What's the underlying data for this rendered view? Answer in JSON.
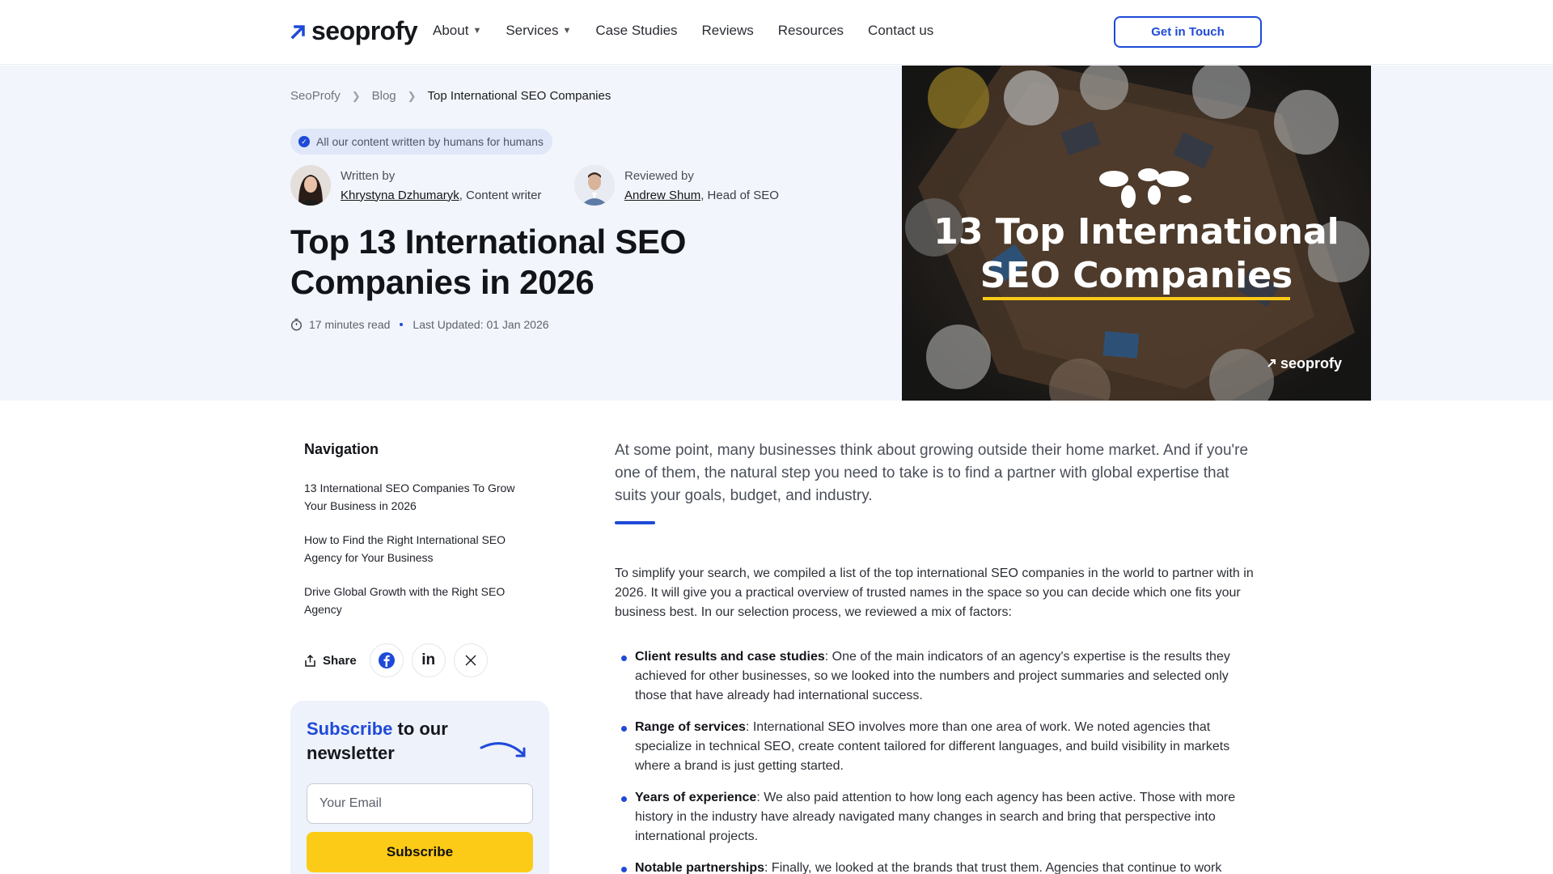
{
  "header": {
    "logo_text": "seoprofy",
    "nav": [
      {
        "label": "About",
        "has_dropdown": true
      },
      {
        "label": "Services",
        "has_dropdown": true
      },
      {
        "label": "Case Studies",
        "has_dropdown": false
      },
      {
        "label": "Reviews",
        "has_dropdown": false
      },
      {
        "label": "Resources",
        "has_dropdown": false
      },
      {
        "label": "Contact us",
        "has_dropdown": false
      }
    ],
    "cta_label": "Get in Touch"
  },
  "breadcrumb": [
    "SeoProfy",
    "Blog",
    "Top International SEO Companies"
  ],
  "badge_text": "All our content written by humans for humans",
  "authors": [
    {
      "role_label": "Written by",
      "name": "Khrystyna Dzhumaryk",
      "title": ", Content writer"
    },
    {
      "role_label": "Reviewed by",
      "name": "Andrew Shum",
      "title": ", Head of SEO"
    }
  ],
  "title": "Top 13 International SEO Companies in 2026",
  "read_time": "17 minutes read",
  "last_updated": "Last Updated: 01 Jan 2026",
  "hero_image": {
    "line1": "13 Top International",
    "line2": "SEO Companies",
    "brand": "seoprofy"
  },
  "sidebar": {
    "nav_title": "Navigation",
    "toc": [
      "13 International SEO Companies To Grow Your Business in 2026",
      "How to Find the Right International SEO Agency for Your Business",
      "Drive Global Growth with the Right SEO Agency"
    ],
    "share_label": "Share"
  },
  "newsletter": {
    "title_highlight": "Subscribe",
    "title_rest": " to our newsletter",
    "input_placeholder": "Your Email",
    "button_label": "Subscribe"
  },
  "article": {
    "lead": "At some point, many businesses think about growing outside their home market. And if you're one of them, the natural step you need to take is to find a partner with global expertise that suits your goals, budget, and industry.",
    "paragraph": "To simplify your search, we compiled a list of the top international SEO companies in the world to partner with in 2026. It will give you a practical overview of trusted names in the space so you can decide which one fits your business best. In our selection process, we reviewed a mix of factors:",
    "bullets": [
      {
        "term": "Client results and case studies",
        "text": ": One of the main indicators of an agency's expertise is the results they achieved for other businesses, so we looked into the numbers and project summaries and selected only those that have already had international success."
      },
      {
        "term": "Range of services",
        "text": ": International SEO involves more than one area of work. We noted agencies that specialize in technical SEO, create content tailored for different languages, and build visibility in markets where a brand is just getting started."
      },
      {
        "term": "Years of experience",
        "text": ": We also paid attention to how long each agency has been active. Those with more history in the industry have already navigated many changes in search and bring that perspective into international projects."
      },
      {
        "term": "Notable partnerships",
        "text": ": Finally, we looked at the brands that trust them. Agencies that continue to work"
      }
    ]
  },
  "colors": {
    "accent": "#1f4ad8",
    "button_yellow": "#fccb17",
    "hero_bg": "#f2f5fb"
  }
}
